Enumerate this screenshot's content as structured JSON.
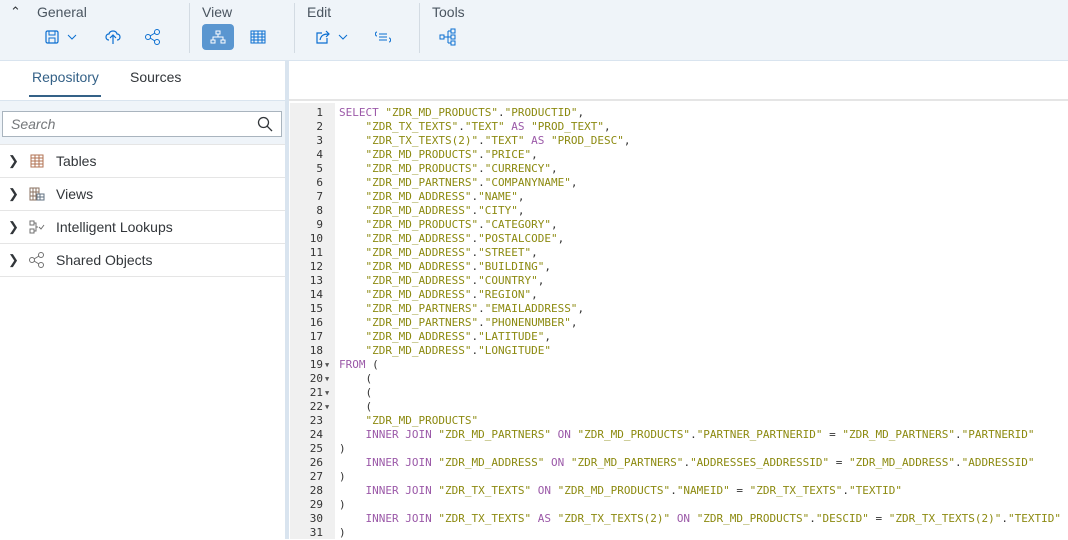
{
  "toolbar": {
    "groups": {
      "general": "General",
      "view": "View",
      "edit": "Edit",
      "tools": "Tools"
    },
    "icons": [
      "save-icon",
      "chevron-down-icon",
      "upload-cloud-icon",
      "share-icon",
      "hierarchy-icon",
      "grid-table-icon",
      "export-icon",
      "chevron-down-icon",
      "format-code-icon",
      "lineage-icon"
    ]
  },
  "left": {
    "tabs": [
      "Repository",
      "Sources"
    ],
    "search_placeholder": "Search",
    "tree": [
      {
        "label": "Tables",
        "icon": "table-icon"
      },
      {
        "label": "Views",
        "icon": "view-icon"
      },
      {
        "label": "Intelligent Lookups",
        "icon": "intelligent-lookup-icon"
      },
      {
        "label": "Shared Objects",
        "icon": "shared-objects-icon"
      }
    ]
  },
  "editor": {
    "lines": [
      "SELECT \"ZDR_MD_PRODUCTS\".\"PRODUCTID\",",
      "    \"ZDR_TX_TEXTS\".\"TEXT\" AS \"PROD_TEXT\",",
      "    \"ZDR_TX_TEXTS(2)\".\"TEXT\" AS \"PROD_DESC\",",
      "    \"ZDR_MD_PRODUCTS\".\"PRICE\",",
      "    \"ZDR_MD_PRODUCTS\".\"CURRENCY\",",
      "    \"ZDR_MD_PARTNERS\".\"COMPANYNAME\",",
      "    \"ZDR_MD_ADDRESS\".\"NAME\",",
      "    \"ZDR_MD_ADDRESS\".\"CITY\",",
      "    \"ZDR_MD_PRODUCTS\".\"CATEGORY\",",
      "    \"ZDR_MD_ADDRESS\".\"POSTALCODE\",",
      "    \"ZDR_MD_ADDRESS\".\"STREET\",",
      "    \"ZDR_MD_ADDRESS\".\"BUILDING\",",
      "    \"ZDR_MD_ADDRESS\".\"COUNTRY\",",
      "    \"ZDR_MD_ADDRESS\".\"REGION\",",
      "    \"ZDR_MD_PARTNERS\".\"EMAILADDRESS\",",
      "    \"ZDR_MD_PARTNERS\".\"PHONENUMBER\",",
      "    \"ZDR_MD_ADDRESS\".\"LATITUDE\",",
      "    \"ZDR_MD_ADDRESS\".\"LONGITUDE\"",
      "FROM (",
      "    (",
      "    (",
      "    (",
      "    \"ZDR_MD_PRODUCTS\"",
      "    INNER JOIN \"ZDR_MD_PARTNERS\" ON \"ZDR_MD_PRODUCTS\".\"PARTNER_PARTNERID\" = \"ZDR_MD_PARTNERS\".\"PARTNERID\"",
      ")",
      "    INNER JOIN \"ZDR_MD_ADDRESS\" ON \"ZDR_MD_PARTNERS\".\"ADDRESSES_ADDRESSID\" = \"ZDR_MD_ADDRESS\".\"ADDRESSID\"",
      ")",
      "    INNER JOIN \"ZDR_TX_TEXTS\" ON \"ZDR_MD_PRODUCTS\".\"NAMEID\" = \"ZDR_TX_TEXTS\".\"TEXTID\"",
      ")",
      "    INNER JOIN \"ZDR_TX_TEXTS\" AS \"ZDR_TX_TEXTS(2)\" ON \"ZDR_MD_PRODUCTS\".\"DESCID\" = \"ZDR_TX_TEXTS(2)\".\"TEXTID\"",
      ")"
    ],
    "folded_lines": [
      19,
      20,
      21,
      22
    ],
    "keywords": [
      "SELECT",
      "AS",
      "FROM",
      "INNER",
      "JOIN",
      "ON"
    ]
  },
  "colors": {
    "keyword": "#9b59a8",
    "string": "#8c8a10",
    "accent": "#0a6ed1",
    "active_button": "#5a96d0"
  }
}
